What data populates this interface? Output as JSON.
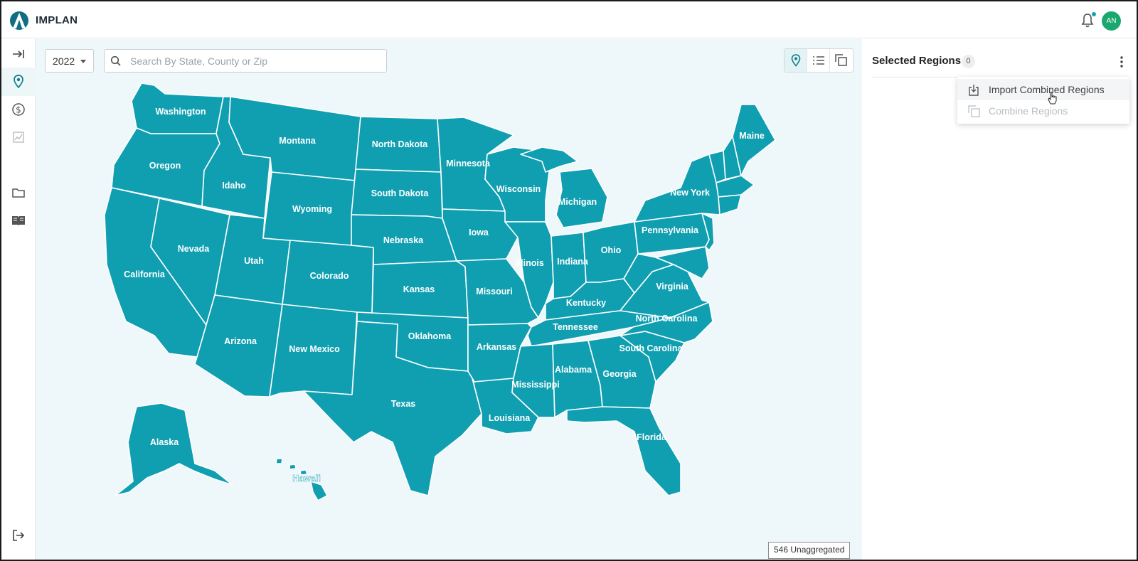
{
  "app": {
    "brand": "IMPLAN",
    "user_initials": "AN"
  },
  "colors": {
    "accent": "#17a3ad",
    "state_fill": "#109fb1",
    "avatar": "#1ba870",
    "map_background": "#eef7f9"
  },
  "rail": {
    "items": [
      {
        "name": "expand-icon"
      },
      {
        "name": "map-pin-icon",
        "active": true
      },
      {
        "name": "dollar-icon"
      },
      {
        "name": "chart-icon"
      },
      {
        "name": "folder-icon"
      },
      {
        "name": "book-icon"
      },
      {
        "name": "logout-icon"
      }
    ]
  },
  "toolbar": {
    "year": "2022",
    "search_placeholder": "Search By State, County or Zip",
    "views": [
      "map-view-icon",
      "list-view-icon",
      "combine-view-icon"
    ]
  },
  "map": {
    "states": [
      "Washington",
      "Oregon",
      "California",
      "Idaho",
      "Montana",
      "Nevada",
      "Utah",
      "Wyoming",
      "Arizona",
      "Colorado",
      "New Mexico",
      "North Dakota",
      "South Dakota",
      "Nebraska",
      "Kansas",
      "Oklahoma",
      "Texas",
      "Minnesota",
      "Iowa",
      "Missouri",
      "Arkansas",
      "Louisiana",
      "Wisconsin",
      "Illinois",
      "Michigan",
      "Indiana",
      "Ohio",
      "Kentucky",
      "Tennessee",
      "Mississippi",
      "Alabama",
      "Georgia",
      "Florida",
      "South Carolina",
      "North Carolina",
      "Virginia",
      "Pennsylvania",
      "New York",
      "Maine",
      "Alaska",
      "Hawaii"
    ],
    "unaggregated": "546 Unaggregated"
  },
  "panel": {
    "title": "Selected Regions",
    "count": "0",
    "menu": {
      "import_label": "Import Combined Regions",
      "combine_label": "Combine Regions"
    }
  }
}
